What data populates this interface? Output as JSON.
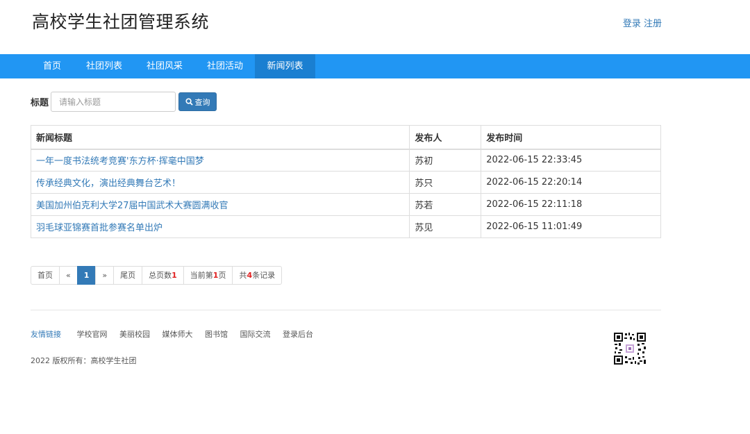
{
  "header": {
    "site_title": "高校学生社团管理系统",
    "login_label": "登录",
    "register_label": "注册"
  },
  "nav": {
    "items": [
      "首页",
      "社团列表",
      "社团风采",
      "社团活动",
      "新闻列表"
    ],
    "active": "新闻列表"
  },
  "search": {
    "label": "标题",
    "placeholder": "请输入标题",
    "value": "",
    "button_label": "查询"
  },
  "news_table": {
    "columns": [
      "新闻标题",
      "发布人",
      "发布时间"
    ],
    "rows": [
      [
        "一年一度书法统考竞赛'东方杯·挥毫中国梦",
        "苏初",
        "2022-06-15 22:33:45"
      ],
      [
        "传承经典文化，演出经典舞台艺术！",
        "苏只",
        "2022-06-15 22:20:14"
      ],
      [
        "美国加州伯克利大学27届中国武术大赛圆满收官",
        "苏若",
        "2022-06-15 22:11:18"
      ],
      [
        "羽毛球亚锦赛首批参赛名单出炉",
        "苏见",
        "2022-06-15 11:01:49"
      ]
    ]
  },
  "pagination": {
    "first_label": "首页",
    "prev_label": "«",
    "current_page": "1",
    "next_label": "»",
    "last_label": "尾页",
    "total_pages_label": "总页数",
    "total_pages": "1",
    "current_prefix": "当前第",
    "current_value": "1",
    "current_suffix": "页",
    "records_prefix": "共",
    "records_count": "4",
    "records_suffix": "条记录"
  },
  "footer": {
    "friend_links_label": "友情链接",
    "links": [
      "学校官网",
      "美丽校园",
      "媒体师大",
      "图书馆",
      "国际交流",
      "登录后台"
    ],
    "copyright": "2022 版权所有：高校学生社团"
  },
  "colors": {
    "nav_bg": "#2196f3",
    "nav_active_bg": "#1a7fd1",
    "link": "#337ab7",
    "button": "#337ab7",
    "highlight_number": "#e02020"
  },
  "icons": {
    "search_button": "search-icon",
    "footer_image": "qr-code"
  }
}
